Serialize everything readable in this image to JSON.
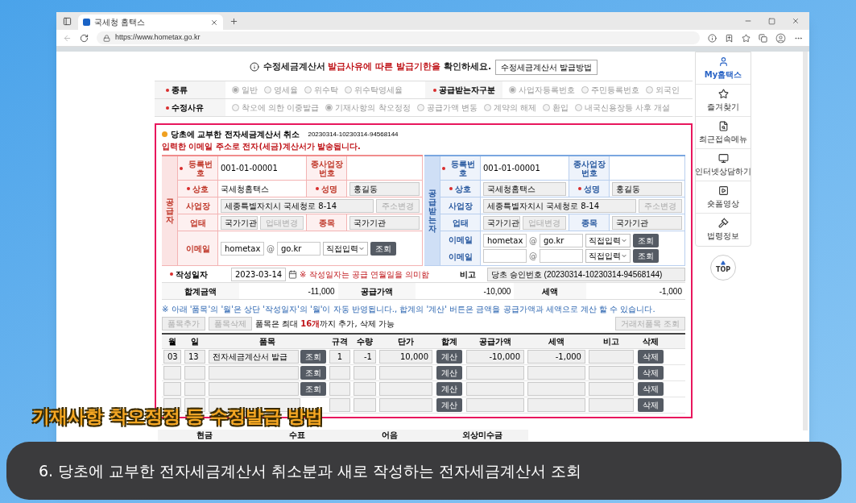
{
  "browser": {
    "tab_title": "국세청 홈택스",
    "url": "https://www.hometax.go.kr"
  },
  "notice": {
    "before": "수정세금계산서 ",
    "highlight": "발급사유에 따른 발급기한을",
    "after": " 확인하세요.",
    "button": "수정세금계산서 발급방법"
  },
  "options": [
    {
      "label": "종류",
      "required": true,
      "choices": [
        {
          "text": "일반",
          "selected": true
        },
        {
          "text": "영세율",
          "selected": false
        },
        {
          "text": "위수탁",
          "selected": false
        },
        {
          "text": "위수탁영세율",
          "selected": false
        }
      ],
      "label2": "공급받는자구분",
      "choices2": [
        {
          "text": "사업자등록번호",
          "selected": true
        },
        {
          "text": "주민등록번호",
          "selected": false
        },
        {
          "text": "외국인",
          "selected": false
        }
      ]
    },
    {
      "label": "수정사유",
      "required": true,
      "choices": [
        {
          "text": "착오에 의한 이중발급",
          "selected": false
        },
        {
          "text": "기재사항의 착오정정",
          "selected": true
        },
        {
          "text": "공급가액 변동",
          "selected": false
        },
        {
          "text": "계약의 해제",
          "selected": false
        },
        {
          "text": "환입",
          "selected": false
        },
        {
          "text": "내국신용장등 사후 개설",
          "selected": false
        }
      ]
    }
  ],
  "invoice": {
    "title": "당초에 교부한 전자세금계산서 취소",
    "number": "20230314-10230314-94568144",
    "warning": "입력한 이메일 주소로 전자(세금)계산서가 발송됩니다.",
    "parties": [
      {
        "side": "공급자",
        "reg_label": {
          "text": "등록번호",
          "required": true
        },
        "reg_no": "001-01-00001",
        "sub_label": {
          "text": "종사업장번호",
          "required": false
        },
        "name_label": {
          "text": "상호",
          "required": true
        },
        "name": "국세청홈택스",
        "rep_label": {
          "text": "성명",
          "required": true
        },
        "rep": "홍길동",
        "addr_label": "사업장",
        "addr": "세종특별자치시 국세청로 8-14",
        "addr_button": "주소변경",
        "type_label": "업태",
        "type": "국가기관",
        "type_button": "업태변경",
        "item_label": "종목",
        "item": "국가기관",
        "emails": [
          {
            "label": "이메일",
            "id": "hometax",
            "at": "@",
            "domain": "go.kr",
            "select": "직접입력",
            "button": "조회"
          }
        ]
      },
      {
        "side": "공급받는자",
        "reg_label": {
          "text": "등록번호",
          "required": true
        },
        "reg_no": "001-01-00001",
        "sub_label": {
          "text": "종사업장번호",
          "required": false
        },
        "name_label": {
          "text": "상호",
          "required": true
        },
        "name": "국세청홈택스",
        "rep_label": {
          "text": "성명",
          "required": true
        },
        "rep": "홍길동",
        "addr_label": "사업장",
        "addr": "세종특별자치시 국세청로 8-14",
        "addr_button": "주소변경",
        "type_label": "업태",
        "type": "국가기관",
        "type_button": "업태변경",
        "item_label": "종목",
        "item": "국가기관",
        "emails": [
          {
            "label": "이메일",
            "id": "hometax",
            "at": "@",
            "domain": "go.kr",
            "select": "직접입력",
            "button": "조회"
          },
          {
            "label": "이메일",
            "at": "@",
            "select": "직접입력",
            "button": "조회"
          }
        ]
      }
    ],
    "date_label": "작성일자",
    "date": "2023-03-14",
    "date_note": "※ 작성일자는 공급 연월일을 의미함",
    "memo_label": "비고",
    "memo": "당초 승인번호 (20230314-10230314-94568144)",
    "totals": [
      {
        "label": "합계금액",
        "value": "-11,000"
      },
      {
        "label": "공급가액",
        "value": "-10,000"
      },
      {
        "label": "세액",
        "value": "-1,000"
      }
    ],
    "info": "※ 아래 '품목'의 '월'은 상단 '작성일자'의 '월'이 자동 반영됩니다., 합계의 '계산' 버튼은 금액을 공급가액과 세액으로 계산 할 수 있습니다.",
    "add_button": "품목추가",
    "delete_button": "품목삭제",
    "limit_note": "품목은 최대 **16개**까지 추가, 삭제 가능",
    "partner_button": "거래처품목 조회",
    "columns": [
      "월",
      "일",
      "품목",
      "규격",
      "수량",
      "단가",
      "합계",
      "공급가액",
      "세액",
      "비고",
      "삭제"
    ],
    "rows": [
      {
        "month": "03",
        "day": "13",
        "item": "전자세금계산서 발급",
        "lookup": "조회",
        "spec": "1",
        "qty": "-1",
        "price": "10,000",
        "calc": "계산",
        "supply": "-10,000",
        "tax": "-1,000",
        "delete": "삭제"
      },
      {
        "lookup": "조회",
        "calc": "계산",
        "delete": "삭제"
      },
      {
        "lookup": "조회",
        "calc": "계산",
        "delete": "삭제"
      },
      {
        "calc": "계산",
        "delete": "삭제"
      }
    ],
    "payment_columns": [
      "현금",
      "수표",
      "어음",
      "외상미수금"
    ]
  },
  "sidebar": [
    {
      "label": "My홈택스",
      "kind": "user",
      "selected": true
    },
    {
      "label": "즐겨찾기",
      "kind": "star",
      "selected": false
    },
    {
      "label": "최근접속메뉴",
      "kind": "search",
      "selected": false
    },
    {
      "label": "인터넷상담하기",
      "kind": "monitor",
      "selected": false
    },
    {
      "label": "숏폼영상",
      "kind": "video",
      "selected": false
    },
    {
      "label": "법령정보",
      "kind": "gavel",
      "selected": false
    }
  ],
  "top_button": "TOP",
  "caption": {
    "title": "기재사항 착오정정 등 수정발급 방법",
    "subtitle": "6. 당초에 교부한 전자세금계산서 취소분과 새로 작성하는 전자세금계산서 조회"
  }
}
